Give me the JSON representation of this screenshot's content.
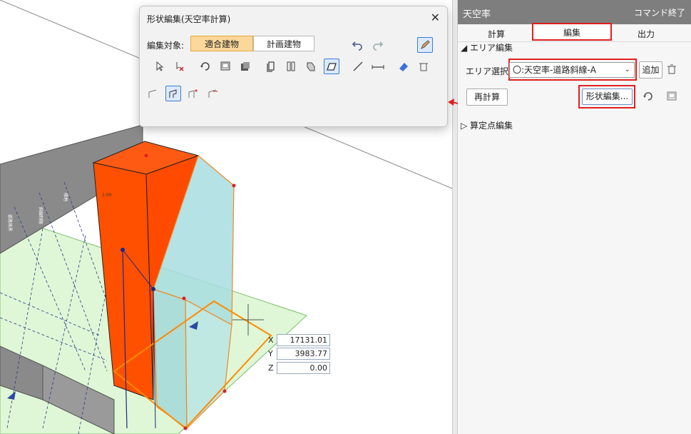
{
  "dialog": {
    "title": "形状編集(天空率計算)",
    "close_glyph": "✕",
    "target_label": "編集対象:",
    "target_options": [
      "適合建物",
      "計画建物"
    ],
    "target_selected": "適合建物"
  },
  "coords": {
    "x_label": "X",
    "x_value": "17131.01",
    "y_label": "Y",
    "y_value": "3983.77",
    "z_label": "Z",
    "z_value": "0.00"
  },
  "panel": {
    "title": "天空率",
    "end_command": "コマンド終了",
    "tabs": [
      "計算",
      "編集",
      "出力"
    ],
    "active_tab": "編集",
    "area_section": "エリア編集",
    "area_select_label": "エリア選択",
    "area_select_value": "〇:天空率-道路斜線-A",
    "add_button": "追加",
    "recalc_button": "再計算",
    "shape_edit_button": "形状編集...",
    "calc_points_section": "算定点編集"
  },
  "viewport": {
    "scene_labels": [
      "1:00",
      "斜線制限",
      "道路境界",
      "隣地"
    ]
  },
  "colors": {
    "accent_red": "#e02020",
    "building_orange": "#ff5000",
    "plan_cyan": "#a7dde0",
    "ground_green": "#dff7d6",
    "selected_segment": "#fbd89a"
  }
}
